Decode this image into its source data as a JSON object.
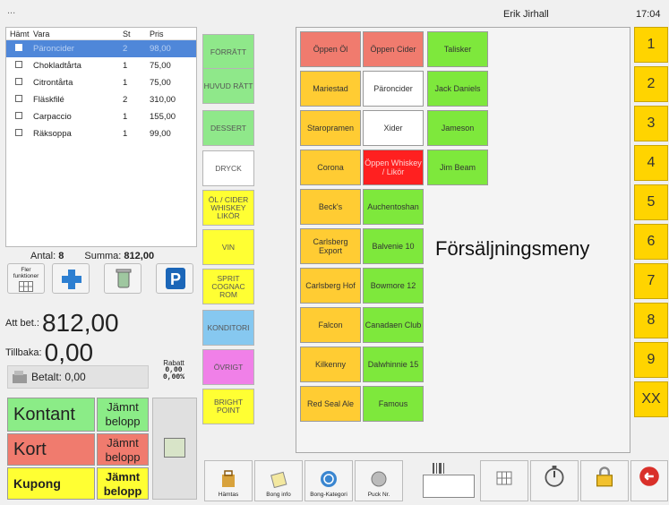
{
  "topbar": {
    "dots": "...",
    "user": "Erik Jirhall",
    "time": "17:04"
  },
  "order": {
    "headers": [
      "Hämt",
      "Vara",
      "St",
      "Pris"
    ],
    "rows": [
      {
        "item": "Päroncider",
        "qty": "2",
        "price": "98,00",
        "selected": true
      },
      {
        "item": "Chokladtårta",
        "qty": "1",
        "price": "75,00"
      },
      {
        "item": "Citrontårta",
        "qty": "1",
        "price": "75,00"
      },
      {
        "item": "Fläskfilé",
        "qty": "2",
        "price": "310,00"
      },
      {
        "item": "Carpaccio",
        "qty": "1",
        "price": "155,00"
      },
      {
        "item": "Räksoppa",
        "qty": "1",
        "price": "99,00"
      }
    ],
    "antal_label": "Antal:",
    "antal_value": "8",
    "summa_label": "Summa:",
    "summa_value": "812,00"
  },
  "actions": {
    "fler_funktioner": "Fler funktioner"
  },
  "payment": {
    "att_bet_label": "Att bet.:",
    "att_bet_value": "812,00",
    "tillbaka_label": "Tillbaka:",
    "tillbaka_value": "0,00",
    "betalt": "Betalt: 0,00",
    "rabatt_label": "Rabatt",
    "rabatt_amount": "0,00",
    "rabatt_percent": "0,00%",
    "kontant": "Kontant",
    "kort": "Kort",
    "kupong": "Kupong",
    "jamnt_belopp": "Jämnt belopp"
  },
  "categories": [
    {
      "label": "FÖRRÄTT",
      "color": "#8fe88a"
    },
    {
      "label": "HUVUD RÄTT",
      "color": "#8fe88a"
    },
    {
      "label": "DESSERT",
      "color": "#8fe88a"
    },
    {
      "label": "DRYCK",
      "color": "#ffffff"
    },
    {
      "label": "ÖL / CIDER WHISKEY LIKÖR",
      "color": "#ffff33"
    },
    {
      "label": "VIN",
      "color": "#ffff33"
    },
    {
      "label": "SPRIT COGNAC ROM",
      "color": "#ffff33"
    },
    {
      "label": "KONDITORI",
      "color": "#86c8f0"
    },
    {
      "label": "ÖVRIGT",
      "color": "#f080e8"
    },
    {
      "label": "BRIGHT POINT",
      "color": "#ffff33"
    }
  ],
  "menu": {
    "title": "Försäljningsmeny",
    "col1": [
      {
        "label": "Öppen Öl",
        "color": "#f07b6e"
      },
      {
        "label": "Mariestad",
        "color": "#ffcc33"
      },
      {
        "label": "Staropramen",
        "color": "#ffcc33"
      },
      {
        "label": "Corona",
        "color": "#ffcc33"
      },
      {
        "label": "Beck's",
        "color": "#ffcc33"
      },
      {
        "label": "Carlsberg Export",
        "color": "#ffcc33"
      },
      {
        "label": "Carlsberg Hof",
        "color": "#ffcc33"
      },
      {
        "label": "Falcon",
        "color": "#ffcc33"
      },
      {
        "label": "Kilkenny",
        "color": "#ffcc33"
      },
      {
        "label": "Red Seal Ale",
        "color": "#ffcc33"
      }
    ],
    "col2": [
      {
        "label": "Öppen Cider",
        "color": "#f07b6e"
      },
      {
        "label": "Päroncider",
        "color": "#ffffff"
      },
      {
        "label": "Xider",
        "color": "#ffffff"
      },
      {
        "label": "Öppen Whiskey / Likör",
        "color": "#ff2020"
      },
      {
        "label": "Auchentoshan",
        "color": "#7ee83c"
      },
      {
        "label": "Balvenie 10",
        "color": "#7ee83c"
      },
      {
        "label": "Bowmore 12",
        "color": "#7ee83c"
      },
      {
        "label": "Canadaen Club",
        "color": "#7ee83c"
      },
      {
        "label": "Dalwhinnie 15",
        "color": "#7ee83c"
      },
      {
        "label": "Famous",
        "color": "#7ee83c"
      }
    ],
    "col3": [
      {
        "label": "Talisker",
        "color": "#7ee83c"
      },
      {
        "label": "Jack Daniels",
        "color": "#7ee83c"
      },
      {
        "label": "Jameson",
        "color": "#7ee83c"
      },
      {
        "label": "Jim Beam",
        "color": "#7ee83c"
      }
    ]
  },
  "numpad": [
    "1",
    "2",
    "3",
    "4",
    "5",
    "6",
    "7",
    "8",
    "9",
    "XX"
  ],
  "toolbar": {
    "hamtas": "Hämtas",
    "bong_info": "Bong info",
    "bong_kategori": "Bong-Kategori",
    "puck_nr": "Puck Nr."
  }
}
